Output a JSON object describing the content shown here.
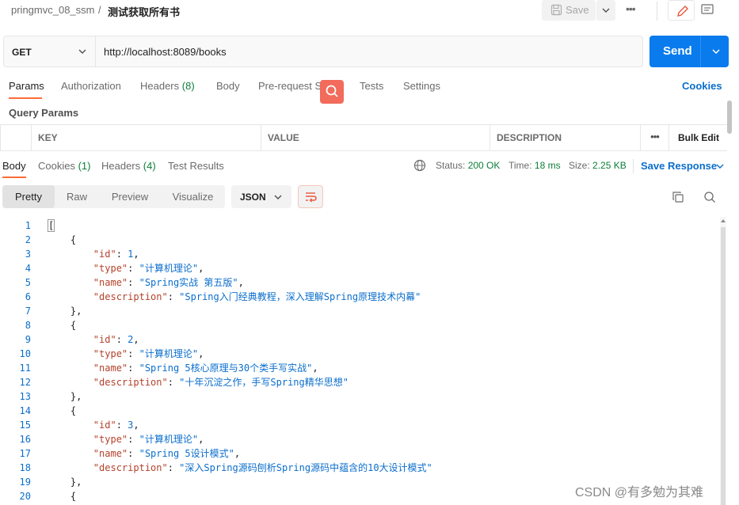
{
  "header": {
    "collection": "pringmvc_08_ssm",
    "separator": "/",
    "request_name": "测试获取所有书",
    "save_label": "Save"
  },
  "request": {
    "method": "GET",
    "url": "http://localhost:8089/books",
    "send_label": "Send"
  },
  "request_tabs": [
    {
      "label": "Params",
      "count": ""
    },
    {
      "label": "Authorization",
      "count": ""
    },
    {
      "label": "Headers",
      "count": "(8)"
    },
    {
      "label": "Body",
      "count": ""
    },
    {
      "label": "Pre-request Script",
      "count": ""
    },
    {
      "label": "Tests",
      "count": ""
    },
    {
      "label": "Settings",
      "count": ""
    }
  ],
  "cookies_link": "Cookies",
  "query_params": {
    "title": "Query Params",
    "columns": [
      "KEY",
      "VALUE",
      "DESCRIPTION"
    ],
    "more": "•••",
    "bulk_edit": "Bulk Edit"
  },
  "response_tabs": [
    {
      "label": "Body",
      "count": ""
    },
    {
      "label": "Cookies",
      "count": "(1)"
    },
    {
      "label": "Headers",
      "count": "(4)"
    },
    {
      "label": "Test Results",
      "count": ""
    }
  ],
  "response_meta": {
    "status_label": "Status:",
    "status_value": "200 OK",
    "time_label": "Time:",
    "time_value": "18 ms",
    "size_label": "Size:",
    "size_value": "2.25 KB",
    "save_response": "Save Response"
  },
  "view_modes": [
    "Pretty",
    "Raw",
    "Preview",
    "Visualize"
  ],
  "format": "JSON",
  "code_lines": [
    {
      "n": "1",
      "indent": "",
      "text": "["
    },
    {
      "n": "2",
      "indent": "    ",
      "text": "{"
    },
    {
      "n": "3",
      "indent": "        ",
      "key": "\"id\"",
      "value": "1",
      "num": true,
      "tail": ","
    },
    {
      "n": "4",
      "indent": "        ",
      "key": "\"type\"",
      "value": "\"计算机理论\"",
      "tail": ","
    },
    {
      "n": "5",
      "indent": "        ",
      "key": "\"name\"",
      "value": "\"Spring实战 第五版\"",
      "tail": ","
    },
    {
      "n": "6",
      "indent": "        ",
      "key": "\"description\"",
      "value": "\"Spring入门经典教程，深入理解Spring原理技术内幕\"",
      "tail": ""
    },
    {
      "n": "7",
      "indent": "    ",
      "text": "},"
    },
    {
      "n": "8",
      "indent": "    ",
      "text": "{"
    },
    {
      "n": "9",
      "indent": "        ",
      "key": "\"id\"",
      "value": "2",
      "num": true,
      "tail": ","
    },
    {
      "n": "10",
      "indent": "        ",
      "key": "\"type\"",
      "value": "\"计算机理论\"",
      "tail": ","
    },
    {
      "n": "11",
      "indent": "        ",
      "key": "\"name\"",
      "value": "\"Spring 5核心原理与30个类手写实战\"",
      "tail": ","
    },
    {
      "n": "12",
      "indent": "        ",
      "key": "\"description\"",
      "value": "\"十年沉淀之作，手写Spring精华思想\"",
      "tail": ""
    },
    {
      "n": "13",
      "indent": "    ",
      "text": "},"
    },
    {
      "n": "14",
      "indent": "    ",
      "text": "{"
    },
    {
      "n": "15",
      "indent": "        ",
      "key": "\"id\"",
      "value": "3",
      "num": true,
      "tail": ","
    },
    {
      "n": "16",
      "indent": "        ",
      "key": "\"type\"",
      "value": "\"计算机理论\"",
      "tail": ","
    },
    {
      "n": "17",
      "indent": "        ",
      "key": "\"name\"",
      "value": "\"Spring 5设计模式\"",
      "tail": ","
    },
    {
      "n": "18",
      "indent": "        ",
      "key": "\"description\"",
      "value": "\"深入Spring源码刨析Spring源码中蕴含的10大设计模式\"",
      "tail": ""
    },
    {
      "n": "19",
      "indent": "    ",
      "text": "},"
    },
    {
      "n": "20",
      "indent": "    ",
      "text": "{"
    }
  ],
  "watermark": "CSDN @有多勉为其难",
  "colors": {
    "accent": "#ff6c37",
    "send": "#097bed",
    "link": "#0b6ecc",
    "status_ok": "#0d7d3a"
  }
}
